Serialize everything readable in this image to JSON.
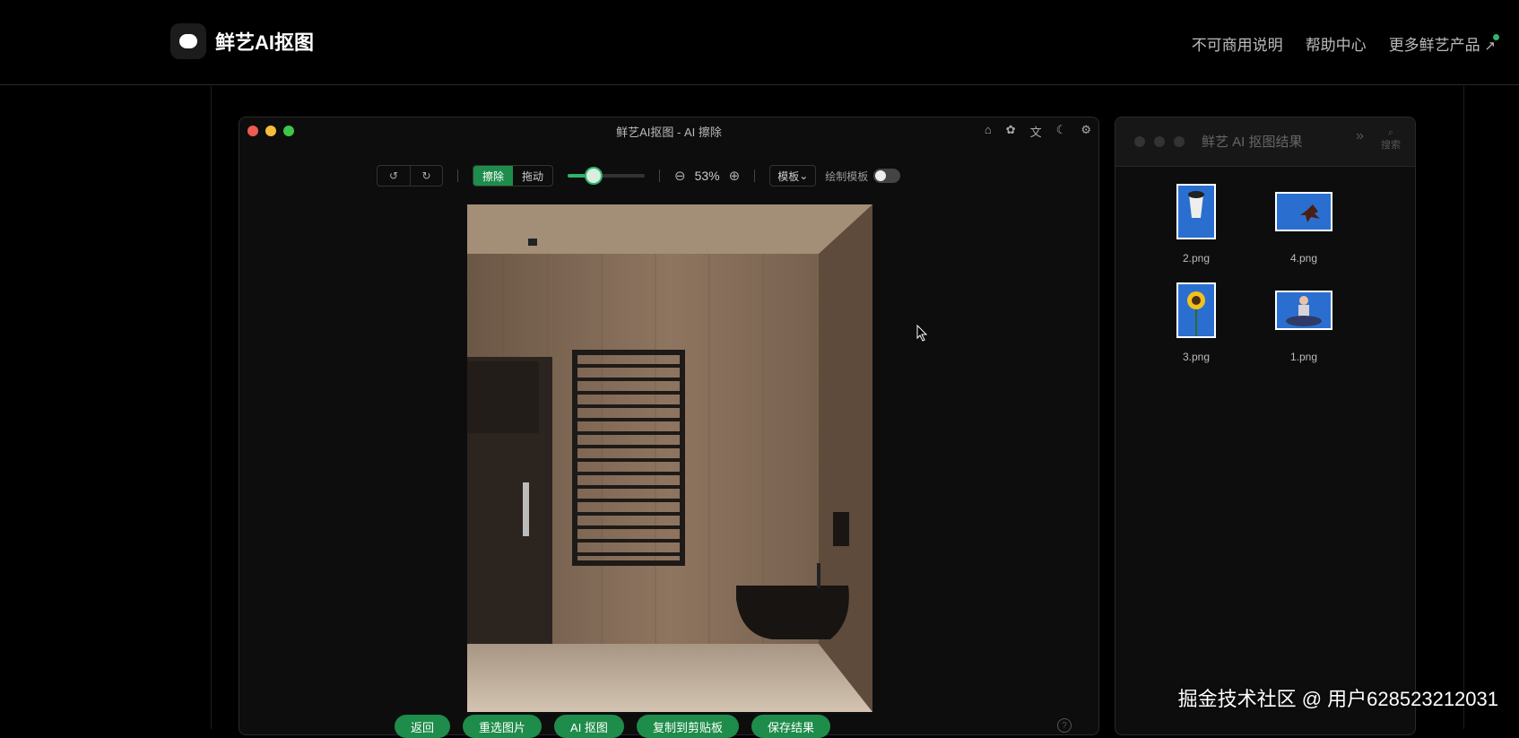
{
  "brand": {
    "name": "鲜艺AI抠图"
  },
  "nav": {
    "item1": "不可商用说明",
    "item2": "帮助中心",
    "item3": "更多鲜艺产品"
  },
  "main_window": {
    "title": "鲜艺AI抠图 - AI 擦除",
    "toolbar": {
      "mode_erase": "擦除",
      "mode_drag": "拖动",
      "brush_size_fraction": 0.34,
      "zoom": "53%",
      "template": "模板",
      "draw_template": "绘制模板"
    },
    "bottom_buttons": [
      "返回",
      "重选图片",
      "AI 抠图",
      "复制到剪贴板",
      "保存结果"
    ]
  },
  "side_window": {
    "title": "鲜艺 AI 抠图结果",
    "search_label": "搜索",
    "files": [
      {
        "name": "2.png",
        "subject": "cup"
      },
      {
        "name": "4.png",
        "subject": "leaf"
      },
      {
        "name": "3.png",
        "subject": "sunflower"
      },
      {
        "name": "1.png",
        "subject": "person"
      }
    ]
  },
  "watermark": "掘金技术社区 @ 用户628523212031",
  "colors": {
    "accent": "#1e8c4a",
    "thumb_bg": "#2a6fd0",
    "background": "#000000"
  }
}
